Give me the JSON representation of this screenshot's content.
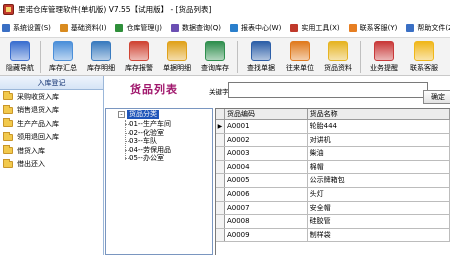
{
  "window": {
    "title": "里诺仓库管理软件(单机版) V7.55【试用版】 - [货品列表]"
  },
  "menubar": {
    "items": [
      {
        "label": "系统设置(S)",
        "icon": "settings-icon",
        "color": "#3a6fc4"
      },
      {
        "label": "基础资料(I)",
        "icon": "data-icon",
        "color": "#d98b1f"
      },
      {
        "label": "仓库管理(J)",
        "icon": "warehouse-icon",
        "color": "#2f8f3a"
      },
      {
        "label": "数据查询(Q)",
        "icon": "query-icon",
        "color": "#6b4fb3"
      },
      {
        "label": "报表中心(W)",
        "icon": "report-icon",
        "color": "#2a7fcc"
      },
      {
        "label": "实用工具(X)",
        "icon": "tools-icon",
        "color": "#c0392b"
      },
      {
        "label": "联系客服(Y)",
        "icon": "support-icon",
        "color": "#e67e22"
      },
      {
        "label": "帮助文件(Z)",
        "icon": "help-icon",
        "color": "#3a6fc4"
      }
    ]
  },
  "toolbar": {
    "buttons": [
      {
        "label": "隐藏导航",
        "icon": "hide-nav-icon",
        "color": "#3b6fd0"
      },
      {
        "label": "库存汇总",
        "icon": "stock-summary-icon",
        "color": "#4b8fd9"
      },
      {
        "label": "库存明细",
        "icon": "stock-detail-icon",
        "color": "#3a7bbf"
      },
      {
        "label": "库存报警",
        "icon": "stock-alarm-icon",
        "color": "#d04535"
      },
      {
        "label": "单据明细",
        "icon": "bill-detail-icon",
        "color": "#e0a21b"
      },
      {
        "label": "查询库存",
        "icon": "query-stock-icon",
        "color": "#2f8f4e"
      },
      {
        "label": "查找单据",
        "icon": "find-bill-icon",
        "color": "#2d5fa8"
      },
      {
        "label": "往来单位",
        "icon": "partners-icon",
        "color": "#e07b1f"
      },
      {
        "label": "货品资料",
        "icon": "goods-icon",
        "color": "#e6b422"
      },
      {
        "label": "业务提醒",
        "icon": "reminder-icon",
        "color": "#c93a3a"
      },
      {
        "label": "联系客服",
        "icon": "support-icon",
        "color": "#f0b71a"
      }
    ]
  },
  "sidebar": {
    "header": "入库登记",
    "items": [
      {
        "label": "采购收货入库"
      },
      {
        "label": "销售退货入库"
      },
      {
        "label": "生产产品入库"
      },
      {
        "label": "领用退回入库"
      },
      {
        "label": "借货入库"
      },
      {
        "label": "借出还入"
      }
    ]
  },
  "main": {
    "title": "货品列表",
    "keyword_label": "关键字",
    "keyword_value": "",
    "search_button": "确定"
  },
  "tree": {
    "root": "货品分类",
    "toggle": "-",
    "nodes": [
      "01--生产车间",
      "02--化验室",
      "03--车队",
      "04--劳保用品",
      "05--办公室"
    ]
  },
  "grid": {
    "columns": [
      "货品编码",
      "货品名称"
    ],
    "current_row_marker": "▶",
    "rows": [
      {
        "code": "A0001",
        "name": "轮胎444"
      },
      {
        "code": "A0002",
        "name": "对讲机"
      },
      {
        "code": "A0003",
        "name": "柴油"
      },
      {
        "code": "A0004",
        "name": "棉帽"
      },
      {
        "code": "A0005",
        "name": "公示牌箱包"
      },
      {
        "code": "A0006",
        "name": "头灯"
      },
      {
        "code": "A0007",
        "name": "安全帽"
      },
      {
        "code": "A0008",
        "name": "硅胶管"
      },
      {
        "code": "A0009",
        "name": "制样袋"
      }
    ]
  }
}
